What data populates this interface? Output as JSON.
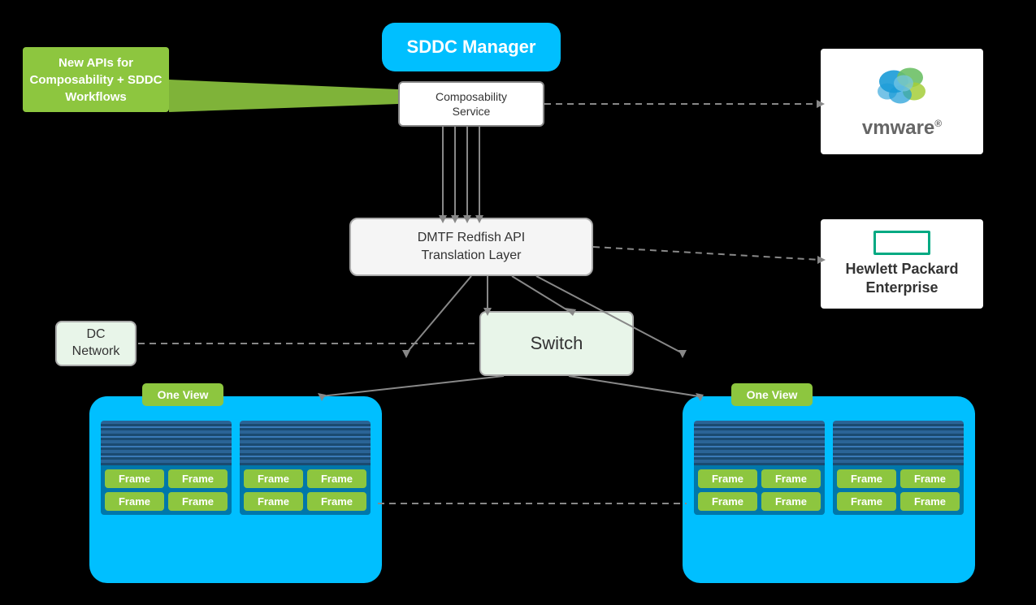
{
  "diagram": {
    "background": "#000000",
    "sddc_manager": {
      "label": "SDDC Manager"
    },
    "composability_service": {
      "label": "Composability\nService"
    },
    "new_apis": {
      "label": "New APIs for\nComposability +\nSDDC Workflows"
    },
    "dmtf": {
      "label": "DMTF Redfish API\nTranslation Layer"
    },
    "switch": {
      "label": "Switch"
    },
    "dc_network": {
      "label": "DC\nNetwork"
    },
    "vmware": {
      "label": "vmware",
      "registered": "®"
    },
    "hpe": {
      "line1": "Hewlett Packard",
      "line2": "Enterprise"
    },
    "oneview_left": {
      "label": "One View"
    },
    "oneview_right": {
      "label": "One View"
    },
    "frames": {
      "label": "Frame"
    },
    "colors": {
      "cyan": "#00BFFF",
      "green": "#8DC63F",
      "white": "#ffffff",
      "dark_gray": "#555555",
      "light_bg": "#f0f8ee",
      "border_gray": "#aaaaaa"
    }
  }
}
